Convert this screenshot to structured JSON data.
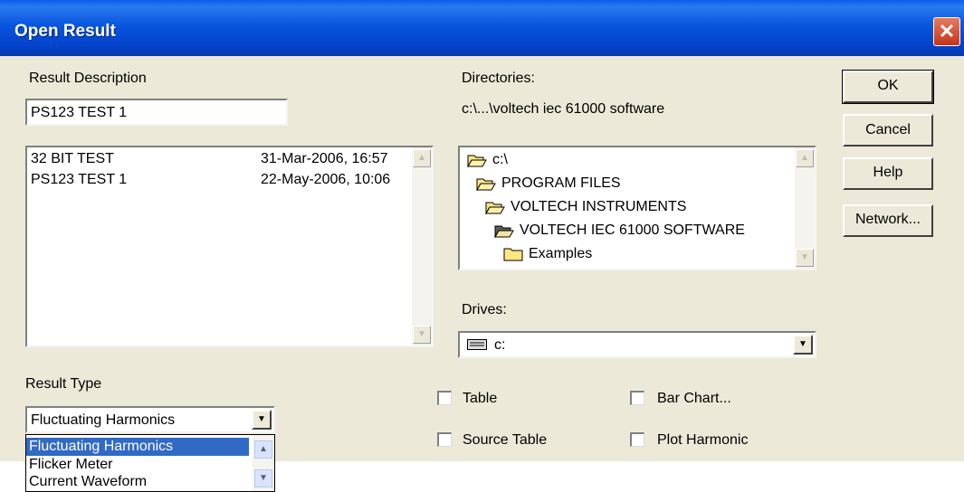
{
  "window": {
    "title": "Open Result",
    "close_label": "✕"
  },
  "result_description": {
    "label": "Result Description",
    "value": "PS123 TEST 1",
    "list": [
      {
        "name": "32 BIT TEST",
        "date": "31-Mar-2006, 16:57"
      },
      {
        "name": "PS123 TEST 1",
        "date": "22-May-2006, 10:06"
      }
    ]
  },
  "directories": {
    "label": "Directories:",
    "current_path": "c:\\...\\voltech iec 61000 software",
    "tree": [
      "c:\\",
      "PROGRAM FILES",
      "VOLTECH INSTRUMENTS",
      "VOLTECH IEC 61000 SOFTWARE",
      "Examples"
    ]
  },
  "drives": {
    "label": "Drives:",
    "value": "c:"
  },
  "buttons": {
    "ok": "OK",
    "cancel": "Cancel",
    "help": "Help",
    "network": "Network..."
  },
  "result_type": {
    "label": "Result Type",
    "selected": "Fluctuating Harmonics",
    "options": [
      "Fluctuating Harmonics",
      "Flicker Meter",
      "Current Waveform"
    ]
  },
  "checkboxes": {
    "table": "Table",
    "source_table": "Source Table",
    "bar_chart": "Bar Chart...",
    "plot_harmonic": "Plot Harmonic"
  },
  "colors": {
    "title_bar": "#0855dd",
    "selection": "#316ac5",
    "dialog_bg": "#ece9d8"
  }
}
